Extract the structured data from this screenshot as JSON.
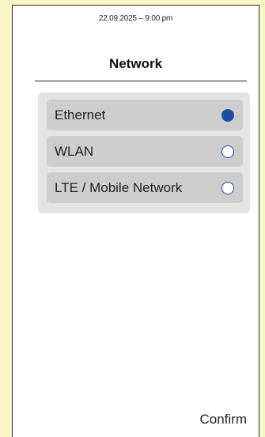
{
  "status_bar": {
    "datetime": "22.09.2025 – 9:00 pm"
  },
  "header": {
    "title": "Network"
  },
  "network_options": [
    {
      "label": "Ethernet",
      "selected": true
    },
    {
      "label": "WLAN",
      "selected": false
    },
    {
      "label": "LTE / Mobile Network",
      "selected": false
    }
  ],
  "footer": {
    "confirm_label": "Confirm"
  },
  "colors": {
    "background": "#fbf6c8",
    "screen": "#ffffff",
    "panel": "#e4e4e4",
    "option": "#cdcdcd",
    "accent": "#1c4fa0"
  }
}
